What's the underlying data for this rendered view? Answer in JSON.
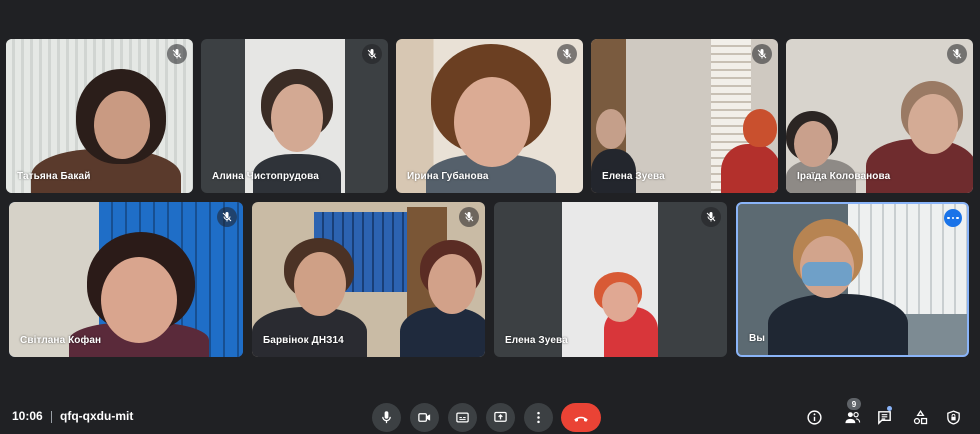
{
  "participants_row1": [
    {
      "name": "Татьяна Бакай"
    },
    {
      "name": "Алина Чистопрудова"
    },
    {
      "name": "Ирина Губанова"
    },
    {
      "name": "Елена Зуева"
    },
    {
      "name": "Іраїда Колованова"
    }
  ],
  "participants_row2": [
    {
      "name": "Світлана Кофан"
    },
    {
      "name": "Барвінок ДНЗ14"
    },
    {
      "name": "Елена Зуева"
    },
    {
      "name": "Вы"
    }
  ],
  "bottom_bar": {
    "time": "10:06",
    "meeting_code": "qfq-qxdu-mit",
    "people_count": "9",
    "icons": [
      "mic-icon",
      "camera-icon",
      "captions-icon",
      "present-icon",
      "more-vert-icon",
      "end-call-icon",
      "info-icon",
      "people-icon",
      "chat-icon",
      "activities-icon",
      "host-controls-icon"
    ]
  },
  "colors": {
    "background": "#202124",
    "end_call": "#ea4335",
    "self_border": "#8ab4f8",
    "more_button": "#1a73e8"
  }
}
